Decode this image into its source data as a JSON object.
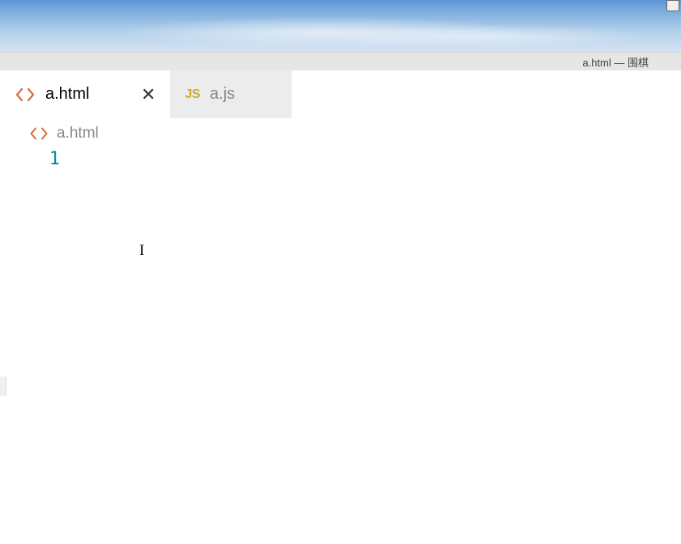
{
  "titleBar": {
    "text": "a.html — 围棋"
  },
  "tabs": [
    {
      "label": "a.html",
      "iconType": "html",
      "active": true,
      "hasClose": true
    },
    {
      "label": "a.js",
      "iconType": "js",
      "jsLabel": "JS",
      "active": false,
      "hasClose": false
    }
  ],
  "breadcrumb": {
    "label": "a.html",
    "iconType": "html"
  },
  "editor": {
    "lineNumbers": [
      "1"
    ],
    "content": ""
  }
}
